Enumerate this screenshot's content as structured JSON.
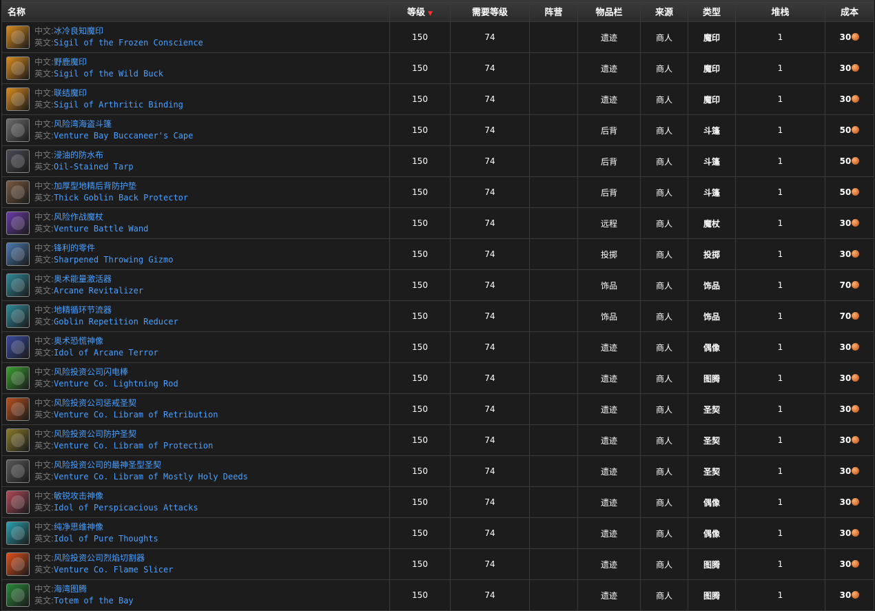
{
  "table": {
    "headers": {
      "name": "名称",
      "level": "等级",
      "req_level": "需要等级",
      "faction": "阵营",
      "slot": "物品栏",
      "source": "来源",
      "type": "类型",
      "stack": "堆栈",
      "cost": "成本"
    },
    "label_zh": "中文:",
    "label_en": "英文:",
    "rows": [
      {
        "zh": "冰冷良知魔印",
        "en": "Sigil of the Frozen Conscience",
        "level": "150",
        "req": "74",
        "faction": "",
        "slot": "遗迹",
        "source": "商人",
        "type": "魔印",
        "stack": "1",
        "cost": "30",
        "icon": "sigil-icon",
        "color": "#d98b1e"
      },
      {
        "zh": "野鹿魔印",
        "en": "Sigil of the Wild Buck",
        "level": "150",
        "req": "74",
        "faction": "",
        "slot": "遗迹",
        "source": "商人",
        "type": "魔印",
        "stack": "1",
        "cost": "30",
        "icon": "sigil-icon",
        "color": "#d98b1e"
      },
      {
        "zh": "联结魔印",
        "en": "Sigil of Arthritic Binding",
        "level": "150",
        "req": "74",
        "faction": "",
        "slot": "遗迹",
        "source": "商人",
        "type": "魔印",
        "stack": "1",
        "cost": "30",
        "icon": "sigil-icon",
        "color": "#d98b1e"
      },
      {
        "zh": "风险湾海盗斗篷",
        "en": "Venture Bay Buccaneer's Cape",
        "level": "150",
        "req": "74",
        "faction": "",
        "slot": "后背",
        "source": "商人",
        "type": "斗篷",
        "stack": "1",
        "cost": "50",
        "icon": "cloak-icon",
        "color": "#6e6e6e"
      },
      {
        "zh": "浸油的防水布",
        "en": "Oil-Stained Tarp",
        "level": "150",
        "req": "74",
        "faction": "",
        "slot": "后背",
        "source": "商人",
        "type": "斗篷",
        "stack": "1",
        "cost": "50",
        "icon": "cloak-icon",
        "color": "#4a4a55"
      },
      {
        "zh": "加厚型地精后背防护垫",
        "en": "Thick Goblin Back Protector",
        "level": "150",
        "req": "74",
        "faction": "",
        "slot": "后背",
        "source": "商人",
        "type": "斗篷",
        "stack": "1",
        "cost": "50",
        "icon": "cloak-icon",
        "color": "#7a5a40"
      },
      {
        "zh": "风险作战魔杖",
        "en": "Venture Battle Wand",
        "level": "150",
        "req": "74",
        "faction": "",
        "slot": "远程",
        "source": "商人",
        "type": "魔杖",
        "stack": "1",
        "cost": "30",
        "icon": "wand-icon",
        "color": "#6a3aa8"
      },
      {
        "zh": "锋利的零件",
        "en": "Sharpened Throwing Gizmo",
        "level": "150",
        "req": "74",
        "faction": "",
        "slot": "投掷",
        "source": "商人",
        "type": "投掷",
        "stack": "1",
        "cost": "30",
        "icon": "throwing-icon",
        "color": "#4a78b0"
      },
      {
        "zh": "奥术能量激活器",
        "en": "Arcane Revitalizer",
        "level": "150",
        "req": "74",
        "faction": "",
        "slot": "饰品",
        "source": "商人",
        "type": "饰品",
        "stack": "1",
        "cost": "70",
        "icon": "trinket-icon",
        "color": "#2e8a9a"
      },
      {
        "zh": "地精循环节流器",
        "en": "Goblin Repetition Reducer",
        "level": "150",
        "req": "74",
        "faction": "",
        "slot": "饰品",
        "source": "商人",
        "type": "饰品",
        "stack": "1",
        "cost": "70",
        "icon": "trinket-icon",
        "color": "#2e8a9a"
      },
      {
        "zh": "奥术恐慌神像",
        "en": "Idol of Arcane Terror",
        "level": "150",
        "req": "74",
        "faction": "",
        "slot": "遗迹",
        "source": "商人",
        "type": "偶像",
        "stack": "1",
        "cost": "30",
        "icon": "idol-icon",
        "color": "#3a4aa0"
      },
      {
        "zh": "风险投资公司闪电棒",
        "en": "Venture Co. Lightning Rod",
        "level": "150",
        "req": "74",
        "faction": "",
        "slot": "遗迹",
        "source": "商人",
        "type": "图腾",
        "stack": "1",
        "cost": "30",
        "icon": "totem-icon",
        "color": "#3aa030"
      },
      {
        "zh": "风险投资公司惩戒圣契",
        "en": "Venture Co. Libram of Retribution",
        "level": "150",
        "req": "74",
        "faction": "",
        "slot": "遗迹",
        "source": "商人",
        "type": "圣契",
        "stack": "1",
        "cost": "30",
        "icon": "libram-icon",
        "color": "#b8501e"
      },
      {
        "zh": "风险投资公司防护圣契",
        "en": "Venture Co. Libram of Protection",
        "level": "150",
        "req": "74",
        "faction": "",
        "slot": "遗迹",
        "source": "商人",
        "type": "圣契",
        "stack": "1",
        "cost": "30",
        "icon": "libram-icon",
        "color": "#8a7a2a"
      },
      {
        "zh": "风险投资公司的最神圣型圣契",
        "en": "Venture Co. Libram of Mostly Holy Deeds",
        "level": "150",
        "req": "74",
        "faction": "",
        "slot": "遗迹",
        "source": "商人",
        "type": "圣契",
        "stack": "1",
        "cost": "30",
        "icon": "libram-icon",
        "color": "#5a5a5a"
      },
      {
        "zh": "敏锐攻击神像",
        "en": "Idol of Perspicacious Attacks",
        "level": "150",
        "req": "74",
        "faction": "",
        "slot": "遗迹",
        "source": "商人",
        "type": "偶像",
        "stack": "1",
        "cost": "30",
        "icon": "idol-icon",
        "color": "#b04a5a"
      },
      {
        "zh": "纯净思维神像",
        "en": "Idol of Pure Thoughts",
        "level": "150",
        "req": "74",
        "faction": "",
        "slot": "遗迹",
        "source": "商人",
        "type": "偶像",
        "stack": "1",
        "cost": "30",
        "icon": "idol-icon",
        "color": "#2aa0b0"
      },
      {
        "zh": "风险投资公司烈焰切割器",
        "en": "Venture Co. Flame Slicer",
        "level": "150",
        "req": "74",
        "faction": "",
        "slot": "遗迹",
        "source": "商人",
        "type": "图腾",
        "stack": "1",
        "cost": "30",
        "icon": "totem-icon",
        "color": "#e0501a"
      },
      {
        "zh": "海湾图腾",
        "en": "Totem of the Bay",
        "level": "150",
        "req": "74",
        "faction": "",
        "slot": "遗迹",
        "source": "商人",
        "type": "图腾",
        "stack": "1",
        "cost": "30",
        "icon": "totem-icon",
        "color": "#2a8a3a"
      }
    ]
  }
}
